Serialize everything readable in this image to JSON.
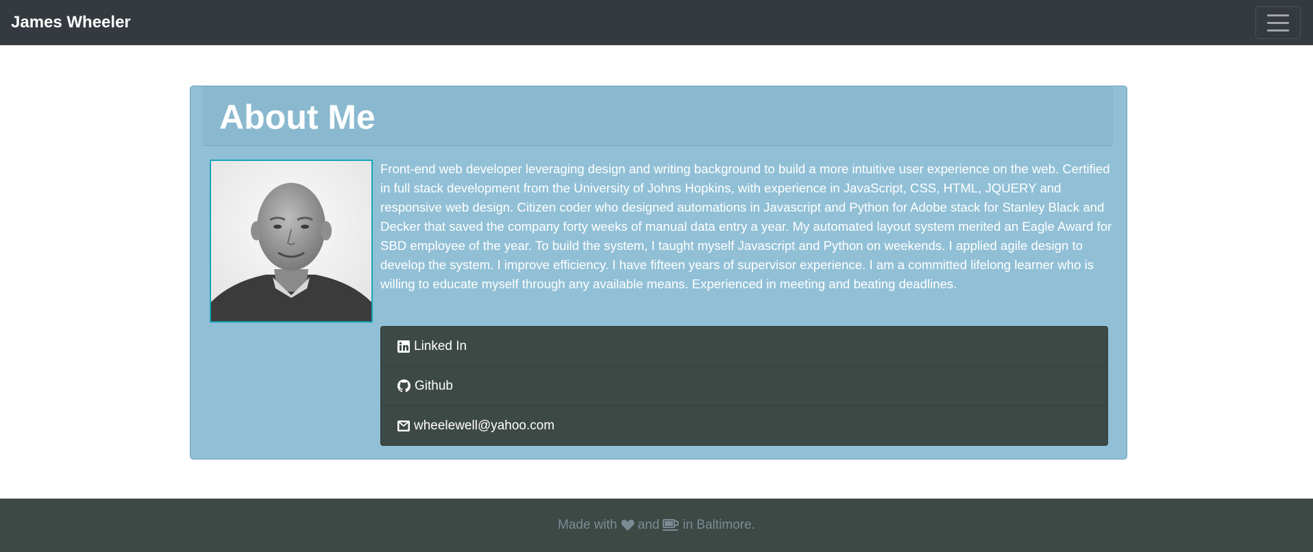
{
  "navbar": {
    "brand": "James Wheeler"
  },
  "about": {
    "title": "About Me",
    "bio": "Front-end web developer leveraging design and writing background to build a more intuitive user experience on the web. Certified in full stack development from the University of Johns Hopkins, with experience in JavaScript, CSS, HTML, JQUERY and responsive web design. Citizen coder who designed automations in Javascript and Python for Adobe stack for Stanley Black and Decker that saved the company forty weeks of manual data entry a year. My automated layout system merited an Eagle Award for SBD employee of the year. To build the system, I taught myself Javascript and Python on weekends. I applied agile design to develop the system. I improve efficiency. I have fifteen years of supervisor experience. I am a committed lifelong learner who is willing to educate myself through any available means. Experienced in meeting and beating deadlines.",
    "links": [
      {
        "label": "Linked In",
        "icon": "linkedin-icon"
      },
      {
        "label": "Github",
        "icon": "github-icon"
      },
      {
        "label": "wheelewell@yahoo.com",
        "icon": "envelope-icon"
      }
    ]
  },
  "footer": {
    "text_before": "Made with",
    "text_middle": "and",
    "text_after": "in Baltimore.",
    "icons": [
      "heart-icon",
      "coffee-icon"
    ]
  },
  "colors": {
    "navbar_bg": "#343a40",
    "card_bg": "#91c0d6",
    "links_bg": "#3d4945",
    "footer_bg": "#3d4945",
    "accent": "#17a2b8"
  }
}
